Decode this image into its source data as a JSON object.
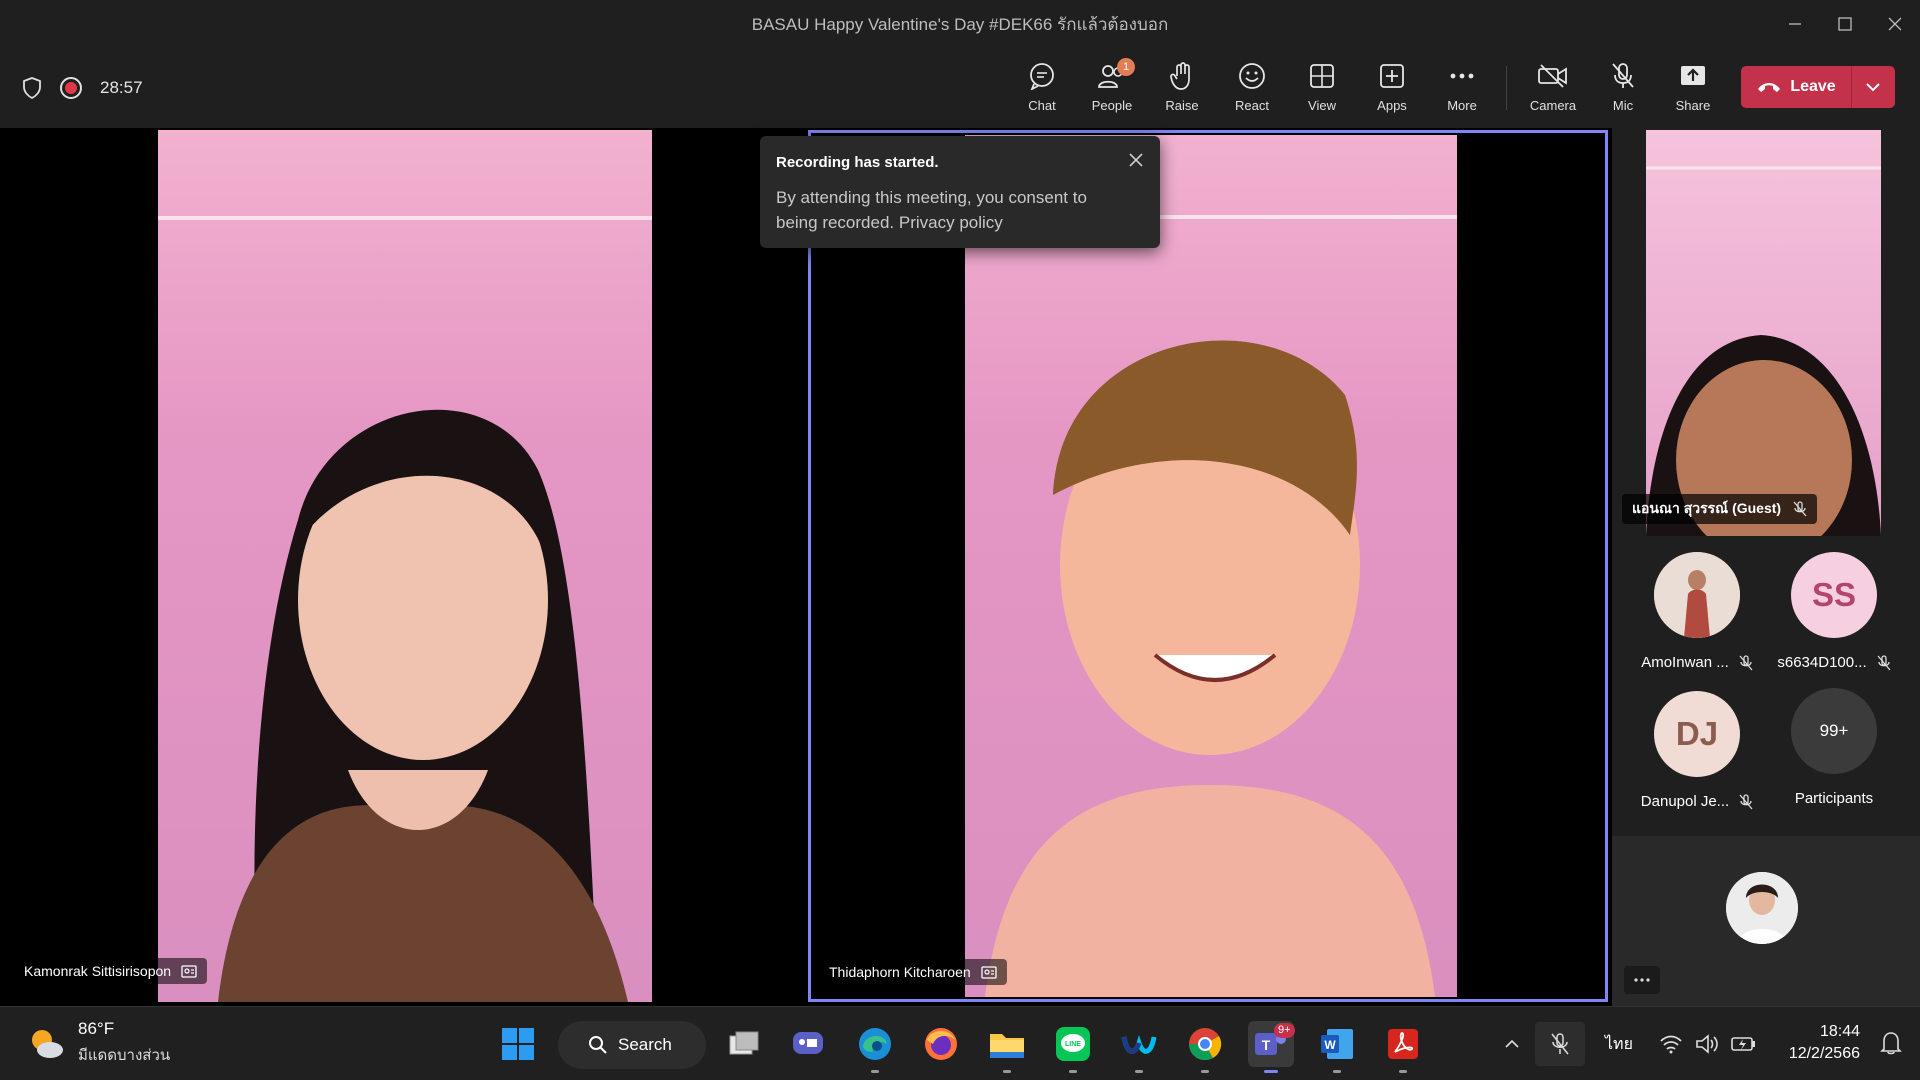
{
  "window": {
    "title": "BASAU Happy Valentine's Day #DEK66 รักแล้วต้องบอก",
    "controls": [
      "minimize",
      "maximize",
      "close"
    ]
  },
  "toolbar": {
    "timer": "28:57",
    "buttons": {
      "chat": "Chat",
      "people": "People",
      "people_badge": "1",
      "raise": "Raise",
      "react": "React",
      "view": "View",
      "apps": "Apps",
      "more": "More",
      "camera": "Camera",
      "mic": "Mic",
      "share": "Share"
    },
    "leave_label": "Leave"
  },
  "toast": {
    "title": "Recording has started.",
    "body": "By attending this meeting, you consent to being recorded. Privacy policy"
  },
  "tiles": [
    {
      "name": "Kamonrak Sittisirisopon"
    },
    {
      "name": "Thidaphorn Kitcharoen"
    }
  ],
  "roster": {
    "guest_name": "แอนณา สุวรรณ์ (Guest)",
    "participants": [
      {
        "label": "AmoInwan ...",
        "initials": "",
        "color": "#d9b9a8"
      },
      {
        "label": "s6634D100...",
        "initials": "SS",
        "color": "#f6cfe0"
      },
      {
        "label": "Danupol Je...",
        "initials": "DJ",
        "color": "#f1dcd5"
      }
    ],
    "overflow": {
      "count": "99+",
      "label": "Participants"
    }
  },
  "taskbar": {
    "weather_temp": "86°F",
    "weather_cond": "มีแดดบางส่วน",
    "search_label": "Search",
    "teams_badge": "9+",
    "language": "ไทย",
    "time": "18:44",
    "date": "12/2/2566"
  },
  "colors": {
    "leave": "#c4314b",
    "active_tile_border": "#7f85f5",
    "recording": "#e3364a",
    "badge": "#e37d54"
  }
}
